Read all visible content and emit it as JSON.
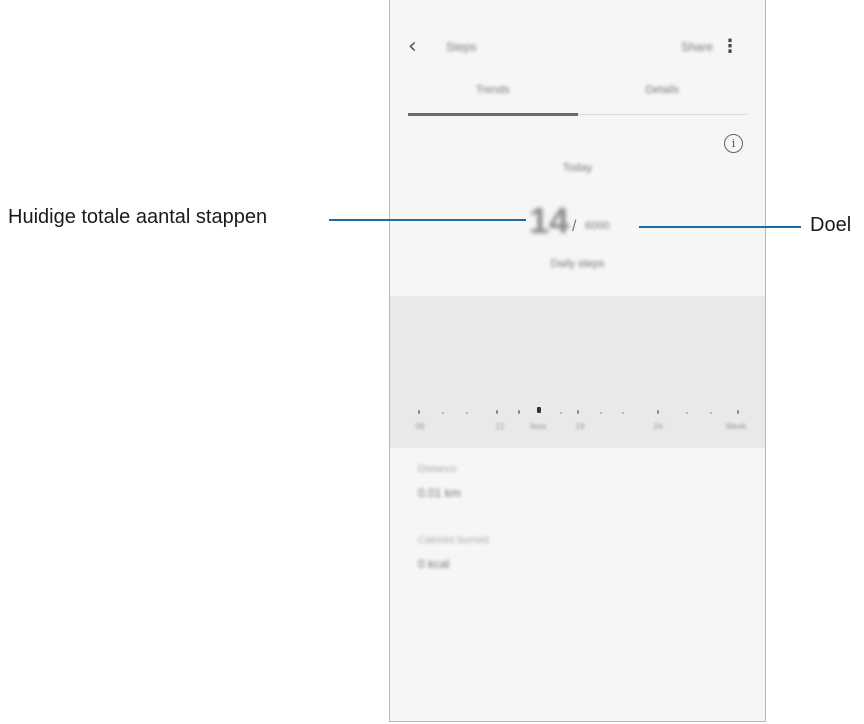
{
  "phone": {
    "app_title": "Steps",
    "action_label": "Share",
    "tabs": [
      "Trends",
      "Details"
    ],
    "today_label": "Today",
    "step_count": "14",
    "slash": "/",
    "goal_value": "6000",
    "unit_label": "Daily steps",
    "chart": {
      "tick_labels": [
        "06",
        "12",
        "Now",
        "18",
        "24",
        "Week"
      ]
    },
    "stats": [
      {
        "label": "Distance",
        "value": "0.01 km"
      },
      {
        "label": "Calories burned",
        "value": "0 kcal"
      }
    ]
  },
  "callouts": {
    "current_steps": "Huidige totale aantal stappen",
    "goal": "Doel"
  },
  "colors": {
    "callout_line": "#1e6aa5",
    "screen_bg": "#f6f6f6",
    "chart_bg": "#e9e9e9"
  },
  "icons": [
    "back-arrow-icon",
    "more-vertical-icon",
    "info-icon"
  ]
}
